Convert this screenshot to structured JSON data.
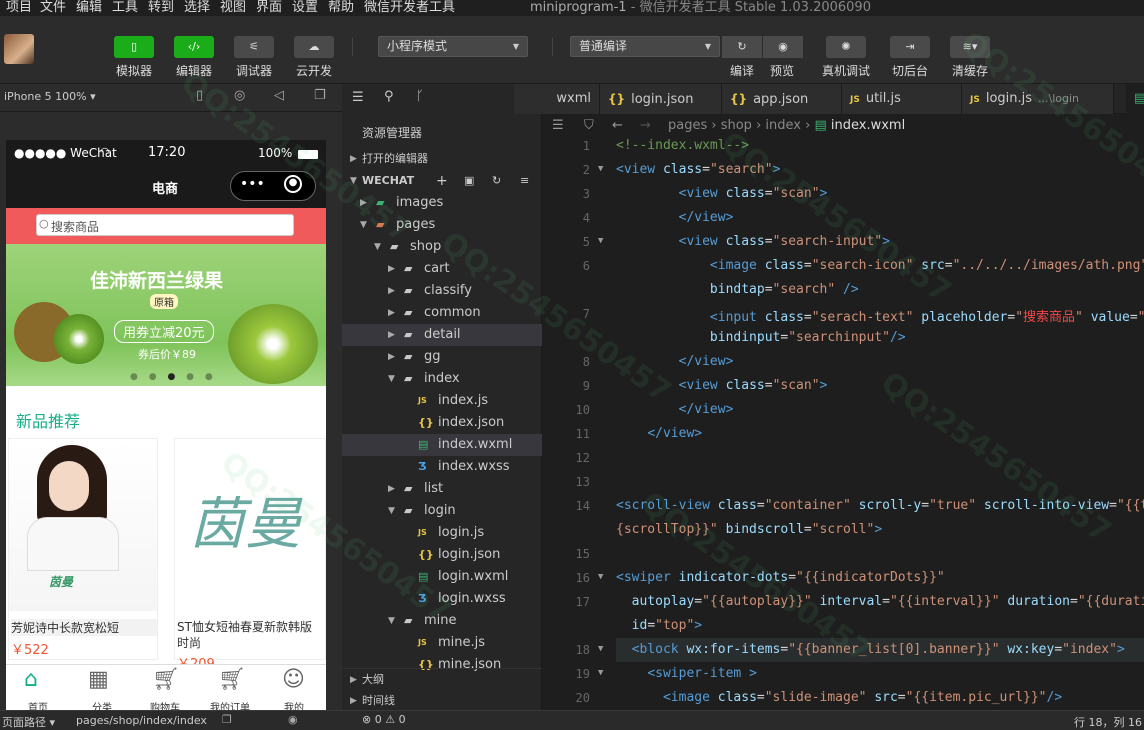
{
  "menu": [
    "项目",
    "文件",
    "编辑",
    "工具",
    "转到",
    "选择",
    "视图",
    "界面",
    "设置",
    "帮助",
    "微信开发者工具"
  ],
  "window_title": "miniprogram-1",
  "window_subtitle": "微信开发者工具 Stable 1.03.2006090",
  "toolbar": {
    "simulator": "模拟器",
    "editor": "编辑器",
    "debugger": "调试器",
    "cloud": "云开发",
    "mode_select": "小程序模式",
    "compile_select": "普通编译",
    "compile": "编译",
    "preview": "预览",
    "remote_debug": "真机调试",
    "background": "切后台",
    "clear_cache": "清缓存"
  },
  "simulator": {
    "device": "iPhone 5 100%",
    "status_carrier": "●●●●● WeChat",
    "status_time": "17:20",
    "status_battery": "100%",
    "nav_title": "电商",
    "search_placeholder": "搜索商品",
    "banner_title": "佳沛新西兰绿果",
    "banner_badge": "原箱",
    "banner_coupon": "用券立减20元",
    "banner_price": "券后价￥89",
    "section_title": "新品推荐",
    "products": [
      {
        "name": "芳妮诗中长款宽松短",
        "price": "￥522"
      },
      {
        "name": "ST恤女短袖春夏新款韩版时尚",
        "price": "￥209"
      }
    ],
    "brand_small": "茵曼",
    "brand_big": "茵曼",
    "tabbar": [
      "首页",
      "分类",
      "购物车",
      "我的订单",
      "我的"
    ]
  },
  "explorer": {
    "title": "资源管理器",
    "open_editors": "打开的编辑器",
    "workspace": "WECHAT",
    "items": [
      {
        "label": "images",
        "depth": 1,
        "type": "folder-img",
        "open": false
      },
      {
        "label": "pages",
        "depth": 1,
        "type": "folder-pages",
        "open": true
      },
      {
        "label": "shop",
        "depth": 2,
        "type": "folder",
        "open": true
      },
      {
        "label": "cart",
        "depth": 3,
        "type": "folder",
        "open": false
      },
      {
        "label": "classify",
        "depth": 3,
        "type": "folder",
        "open": false
      },
      {
        "label": "common",
        "depth": 3,
        "type": "folder",
        "open": false
      },
      {
        "label": "detail",
        "depth": 3,
        "type": "folder",
        "open": false
      },
      {
        "label": "gg",
        "depth": 3,
        "type": "folder",
        "open": false
      },
      {
        "label": "index",
        "depth": 3,
        "type": "folder",
        "open": true
      },
      {
        "label": "index.js",
        "depth": 4,
        "type": "js"
      },
      {
        "label": "index.json",
        "depth": 4,
        "type": "json"
      },
      {
        "label": "index.wxml",
        "depth": 4,
        "type": "wxml"
      },
      {
        "label": "index.wxss",
        "depth": 4,
        "type": "wxss"
      },
      {
        "label": "list",
        "depth": 3,
        "type": "folder",
        "open": false
      },
      {
        "label": "login",
        "depth": 3,
        "type": "folder",
        "open": true
      },
      {
        "label": "login.js",
        "depth": 4,
        "type": "js"
      },
      {
        "label": "login.json",
        "depth": 4,
        "type": "json"
      },
      {
        "label": "login.wxml",
        "depth": 4,
        "type": "wxml"
      },
      {
        "label": "login.wxss",
        "depth": 4,
        "type": "wxss"
      },
      {
        "label": "mine",
        "depth": 3,
        "type": "folder",
        "open": true
      },
      {
        "label": "mine.js",
        "depth": 4,
        "type": "js"
      },
      {
        "label": "mine.json",
        "depth": 4,
        "type": "json"
      }
    ],
    "outline": "大纲",
    "timeline": "时间线"
  },
  "tabs": [
    {
      "label": "wxml",
      "icon": "wxml"
    },
    {
      "label": "login.json",
      "icon": "json"
    },
    {
      "label": "app.json",
      "icon": "json"
    },
    {
      "label": "util.js",
      "icon": "js"
    },
    {
      "label": "login.js",
      "icon": "js",
      "suffix": "...\\login"
    }
  ],
  "breadcrumb": [
    "pages",
    "shop",
    "index",
    "index.wxml"
  ],
  "code_lines": [
    {
      "n": "1",
      "html": "<span class='cm'>&lt;!--index.wxml--&gt;</span>"
    },
    {
      "n": "2",
      "html": "<span class='tg'>&lt;view</span> <span class='at'>class</span>=<span class='sv'>\"search\"</span><span class='tg'>&gt;</span>",
      "fold": true
    },
    {
      "n": "3",
      "html": "        <span class='tg'>&lt;view</span> <span class='at'>class</span>=<span class='sv'>\"scan\"</span><span class='tg'>&gt;</span>"
    },
    {
      "n": "4",
      "html": "        <span class='tg'>&lt;/view&gt;</span>"
    },
    {
      "n": "5",
      "html": "        <span class='tg'>&lt;view</span> <span class='at'>class</span>=<span class='sv'>\"search-input\"</span><span class='tg'>&gt;</span>",
      "fold": true
    },
    {
      "n": "6",
      "html": "            <span class='tg'>&lt;image</span> <span class='at'>class</span>=<span class='sv'>\"search-icon\"</span> <span class='at'>src</span>=<span class='sv'>\"../../../images/ath.png\"</span>"
    },
    {
      "n": "",
      "html": "            <span class='at'>bindtap</span>=<span class='sv'>\"search\"</span> <span class='tg'>/&gt;</span>"
    },
    {
      "n": "7",
      "html": "            <span class='tg'>&lt;input</span> <span class='at'>class</span>=<span class='sv'>\"serach-text\"</span> <span class='at'>placeholder</span>=<span class='sv'>\"</span><span class='zh'>搜索商品</span><span class='sv'>\"</span> <span class='at'>value</span>=<span class='sv'>\"{{</span>"
    },
    {
      "n": "",
      "html": "            <span class='at'>bindinput</span>=<span class='sv'>\"searchinput\"</span><span class='tg'>/&gt;</span>"
    },
    {
      "n": "8",
      "html": "        <span class='tg'>&lt;/view&gt;</span>"
    },
    {
      "n": "9",
      "html": "        <span class='tg'>&lt;view</span> <span class='at'>class</span>=<span class='sv'>\"scan\"</span><span class='tg'>&gt;</span>"
    },
    {
      "n": "10",
      "html": "        <span class='tg'>&lt;/view&gt;</span>"
    },
    {
      "n": "11",
      "html": "    <span class='tg'>&lt;/view&gt;</span>"
    },
    {
      "n": "12",
      "html": ""
    },
    {
      "n": "13",
      "html": ""
    },
    {
      "n": "14",
      "html": "<span class='tg'>&lt;scroll-view</span> <span class='at'>class</span>=<span class='sv'>\"container\"</span> <span class='at'>scroll-y</span>=<span class='sv'>\"true\"</span> <span class='at'>scroll-into-view</span>=<span class='sv'>\"{{to</span>"
    },
    {
      "n": "",
      "html": "<span class='sv'>{scrollTop}}\"</span> <span class='at'>bindscroll</span>=<span class='sv'>\"scroll\"</span><span class='tg'>&gt;</span>"
    },
    {
      "n": "15",
      "html": ""
    },
    {
      "n": "16",
      "html": "<span class='tg'>&lt;swiper</span> <span class='at'>indicator-dots</span>=<span class='sv'>\"{{indicatorDots}}\"</span>",
      "fold": true
    },
    {
      "n": "17",
      "html": "  <span class='at'>autoplay</span>=<span class='sv'>\"{{autoplay}}\"</span> <span class='at'>interval</span>=<span class='sv'>\"{{interval}}\"</span> <span class='at'>duration</span>=<span class='sv'>\"{{duratio</span>"
    },
    {
      "n": "",
      "html": "  <span class='at'>id</span>=<span class='sv'>\"top\"</span><span class='tg'>&gt;</span>"
    },
    {
      "n": "18",
      "html": "  <span class='tg'>&lt;block</span> <span class='at'>wx:for-items</span>=<span class='sv'>\"{{banner_list[0].banner}}\"</span> <span class='at'>wx:key</span>=<span class='sv'>\"index\"</span><span class='tg'>&gt;</span>",
      "fold": true,
      "hl": true
    },
    {
      "n": "19",
      "html": "    <span class='tg'>&lt;swiper-item</span> <span class='tg'>&gt;</span>",
      "fold": true
    },
    {
      "n": "20",
      "html": "      <span class='tg'>&lt;image</span> <span class='at'>class</span>=<span class='sv'>\"slide-image\"</span> <span class='at'>src</span>=<span class='sv'>\"{{item.pic_url}}\"</span><span class='tg'>/&gt;</span>"
    }
  ],
  "status": {
    "page_path_label": "页面路径",
    "page_path": "pages/shop/index/index",
    "errors": "0",
    "warnings": "0",
    "cursor": "行 18，列 16"
  },
  "watermark": "QQ:2545650457"
}
